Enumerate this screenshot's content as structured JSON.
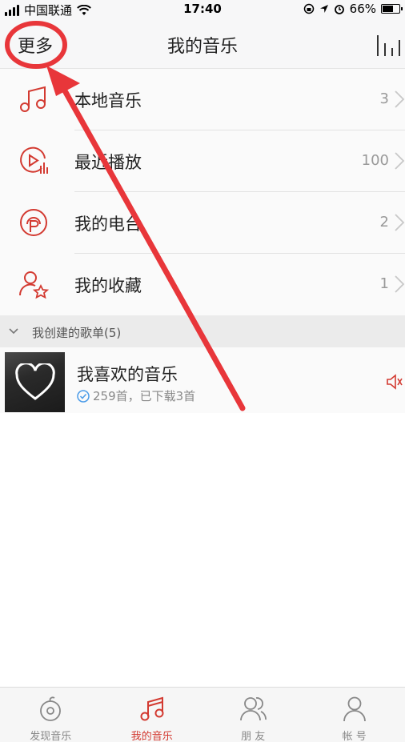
{
  "status_bar": {
    "carrier": "中国联通",
    "time": "17:40",
    "battery_percent": "66%",
    "battery_level": 0.66
  },
  "nav": {
    "more_label": "更多",
    "title": "我的音乐"
  },
  "menu": {
    "items": [
      {
        "label": "本地音乐",
        "count": "3",
        "icon": "music-note-icon"
      },
      {
        "label": "最近播放",
        "count": "100",
        "icon": "recent-play-icon"
      },
      {
        "label": "我的电台",
        "count": "2",
        "icon": "radio-icon"
      },
      {
        "label": "我的收藏",
        "count": "1",
        "icon": "favorite-user-icon"
      }
    ]
  },
  "section": {
    "label": "我创建的歌单(5)"
  },
  "playlist": {
    "name": "我喜欢的音乐",
    "meta": "259首，已下载3首"
  },
  "tabs": [
    {
      "label": "发现音乐",
      "icon": "discover-icon",
      "active": false
    },
    {
      "label": "我的音乐",
      "icon": "my-music-icon",
      "active": true
    },
    {
      "label": "朋 友",
      "icon": "friends-icon",
      "active": false
    },
    {
      "label": "帐 号",
      "icon": "account-icon",
      "active": false
    }
  ],
  "colors": {
    "accent": "#d33a31",
    "annotation": "#e8363a"
  }
}
